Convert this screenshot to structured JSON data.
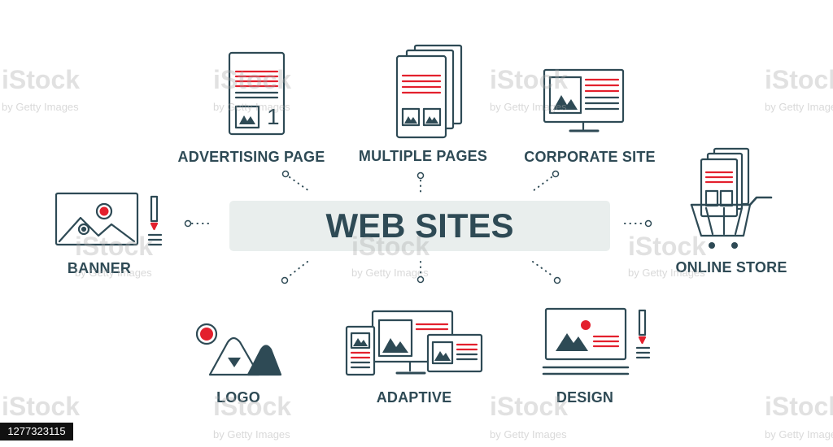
{
  "title": "WEB SITES",
  "colors": {
    "ink": "#2e4a55",
    "accent": "#e3202d",
    "box": "#e9eeed"
  },
  "nodes": [
    {
      "id": "advertising-page",
      "label": "ADVERTISING PAGE",
      "icon": "advertising-page-icon",
      "badge": "1"
    },
    {
      "id": "multiple-pages",
      "label": "MULTIPLE PAGES",
      "icon": "multiple-pages-icon"
    },
    {
      "id": "corporate-site",
      "label": "CORPORATE SITE",
      "icon": "corporate-site-icon"
    },
    {
      "id": "banner",
      "label": "BANNER",
      "icon": "banner-icon"
    },
    {
      "id": "online-store",
      "label": "ONLINE STORE",
      "icon": "online-store-icon"
    },
    {
      "id": "logo",
      "label": "LOGO",
      "icon": "logo-icon"
    },
    {
      "id": "adaptive",
      "label": "ADAPTIVE",
      "icon": "adaptive-icon"
    },
    {
      "id": "design",
      "label": "DESIGN",
      "icon": "design-icon"
    }
  ],
  "watermark": {
    "brand": "iStock",
    "credit": "by Getty Images",
    "stock_id": "1277323115"
  }
}
